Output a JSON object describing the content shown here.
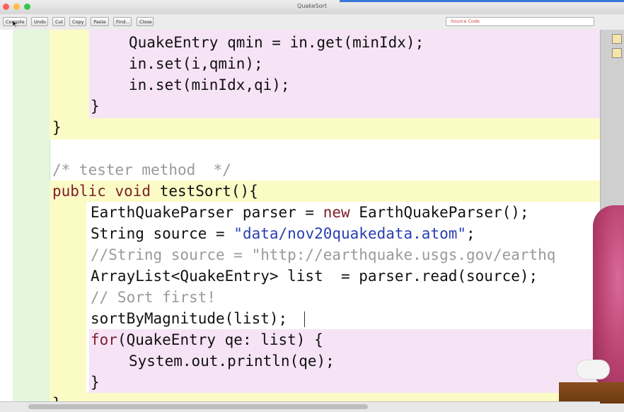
{
  "window": {
    "title": "QuakeSort"
  },
  "toolbar": {
    "buttons": [
      "Compile",
      "Undo",
      "Cut",
      "Copy",
      "Paste",
      "Find...",
      "Close"
    ],
    "view_select": "Source Code"
  },
  "editor": {
    "lines": [
      {
        "segments": [
          {
            "t": "QuakeEntry qmin = in.get(minIdx);",
            "c": "plain"
          }
        ]
      },
      {
        "segments": [
          {
            "t": "in.set(i,qmin);",
            "c": "plain"
          }
        ]
      },
      {
        "segments": [
          {
            "t": "in.set(minIdx,qi);",
            "c": "plain"
          }
        ]
      },
      {
        "segments": [
          {
            "t": "}",
            "c": "plain"
          }
        ]
      },
      {
        "segments": [
          {
            "t": "}",
            "c": "plain"
          }
        ]
      },
      {
        "segments": [
          {
            "t": "",
            "c": "plain"
          }
        ]
      },
      {
        "segments": [
          {
            "t": "/* tester method  */",
            "c": "comment"
          }
        ]
      },
      {
        "segments": [
          {
            "t": "public void",
            "c": "kw"
          },
          {
            "t": " testSort(){",
            "c": "plain"
          }
        ]
      },
      {
        "segments": [
          {
            "t": "EarthQuakeParser parser = ",
            "c": "plain"
          },
          {
            "t": "new",
            "c": "kw"
          },
          {
            "t": " EarthQuakeParser();",
            "c": "plain"
          }
        ]
      },
      {
        "segments": [
          {
            "t": "String source = ",
            "c": "plain"
          },
          {
            "t": "\"data/nov20quakedata.atom\"",
            "c": "str"
          },
          {
            "t": ";",
            "c": "plain"
          }
        ]
      },
      {
        "segments": [
          {
            "t": "//String source = \"http://earthquake.usgs.gov/earthq",
            "c": "comment"
          }
        ]
      },
      {
        "segments": [
          {
            "t": "ArrayList<QuakeEntry> list  = parser.read(source);",
            "c": "plain"
          }
        ]
      },
      {
        "segments": [
          {
            "t": "// Sort first!",
            "c": "comment"
          }
        ]
      },
      {
        "segments": [
          {
            "t": "sortByMagnitude(list);",
            "c": "plain"
          }
        ]
      },
      {
        "segments": [
          {
            "t": "for",
            "c": "kw"
          },
          {
            "t": "(QuakeEntry qe: list) {",
            "c": "plain"
          }
        ]
      },
      {
        "segments": [
          {
            "t": "System.out.println(qe);",
            "c": "plain"
          }
        ]
      },
      {
        "segments": [
          {
            "t": "}",
            "c": "plain"
          }
        ]
      },
      {
        "segments": [
          {
            "t": "}",
            "c": "plain"
          }
        ]
      }
    ]
  },
  "colors": {
    "gutter": "#e4f7de",
    "scope_yellow": "#fbfbc6",
    "scope_pink": "#f6e4f6",
    "keyword": "#7a1f2b",
    "string": "#2a3fb0",
    "comment": "#9a9a9a"
  }
}
